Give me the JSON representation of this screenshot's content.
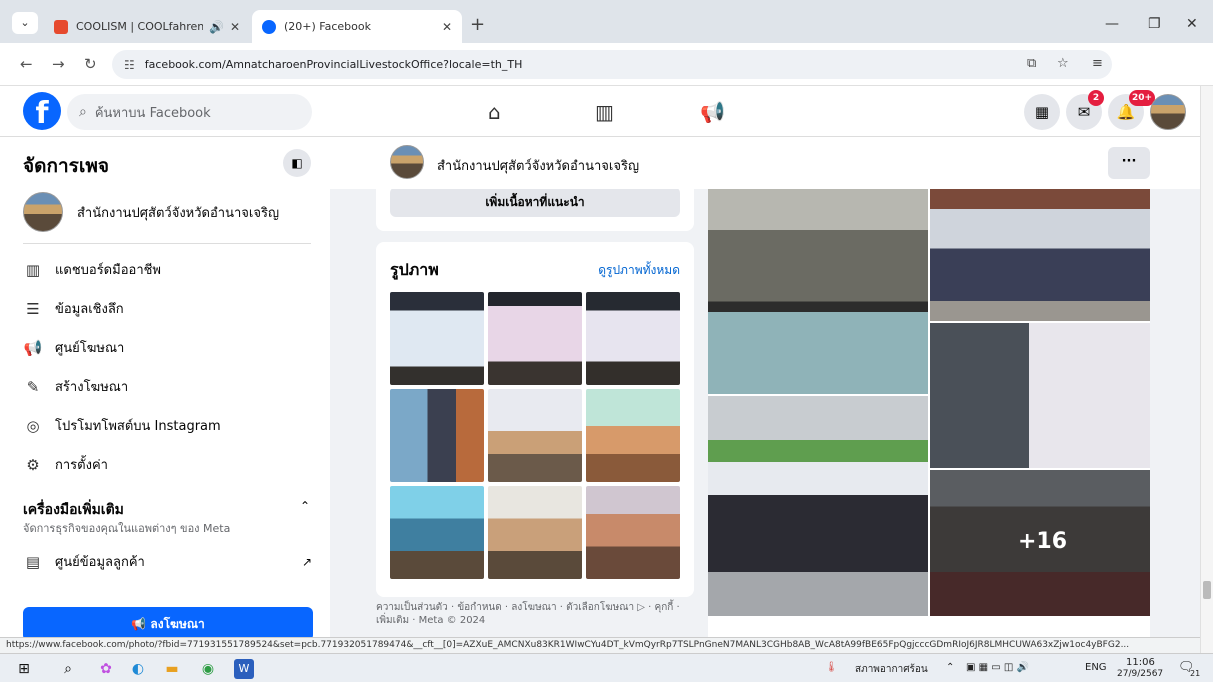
{
  "browser": {
    "tabs": [
      {
        "title": "COOLISM | COOLfahrenheit",
        "color": "#e64a2e"
      },
      {
        "title": "(20+) Facebook",
        "color": "#0866ff"
      }
    ],
    "url": "facebook.com/AmnatcharoenProvincialLivestockOffice?locale=th_TH",
    "profile_letter": "r",
    "status_url": "https://www.facebook.com/photo/?fbid=771931551789524&set=pcb.771932051789474&__cft__[0]=AZXuE_AMCNXu83KR1WIwCYu4DT_kVmQyrRp7TSLPnGneN7MANL3CGHb8AB_WcA8tA99fBE65FpQgjcccGDmRIoJ6JR8LMHCUWA63xZjw1oc4yBFG2..."
  },
  "facebook": {
    "search_placeholder": "ค้นหาบน Facebook",
    "messenger_badge": "2",
    "notif_badge": "20+",
    "brand_color": "#0866ff"
  },
  "sidebar": {
    "title": "จัดการเพจ",
    "page_name": "สำนักงานปศุสัตว์จังหวัดอำนาจเจริญ",
    "items": [
      {
        "label": "แดชบอร์ดมืออาชีพ",
        "icon": "dashboard-icon"
      },
      {
        "label": "ข้อมูลเชิงลึก",
        "icon": "insights-icon"
      },
      {
        "label": "ศูนย์โฆษณา",
        "icon": "megaphone-icon"
      },
      {
        "label": "สร้างโฆษณา",
        "icon": "pencil-icon"
      },
      {
        "label": "โปรโมทโพสต์บน Instagram",
        "icon": "instagram-icon"
      },
      {
        "label": "การตั้งค่า",
        "icon": "gear-icon"
      }
    ],
    "tools_title": "เครื่องมือเพิ่มเติม",
    "tools_subtitle": "จัดการธุรกิจของคุณในแอพต่างๆ ของ Meta",
    "tools_item": "ศูนย์ข้อมูลลูกค้า",
    "ad_button": "ลงโฆษณา"
  },
  "page": {
    "name": "สำนักงานปศุสัตว์จังหวัดอำนาจเจริญ",
    "suggest_button": "เพิ่มเนื้อหาที่แนะนำ",
    "photos_title": "รูปภาพ",
    "see_all": "ดูรูปภาพทั้งหมด",
    "footer": "ความเป็นส่วนตัว · ข้อกำหนด · ลงโฆษณา · ตัวเลือกโฆษณา ▷ · คุกกี้ · เพิ่มเติม · Meta © 2024",
    "more_count": "+16"
  },
  "taskbar": {
    "weather": "สภาพอากาศร้อน",
    "lang": "ENG",
    "time": "11:06",
    "date": "27/9/2567",
    "notif": "21"
  }
}
